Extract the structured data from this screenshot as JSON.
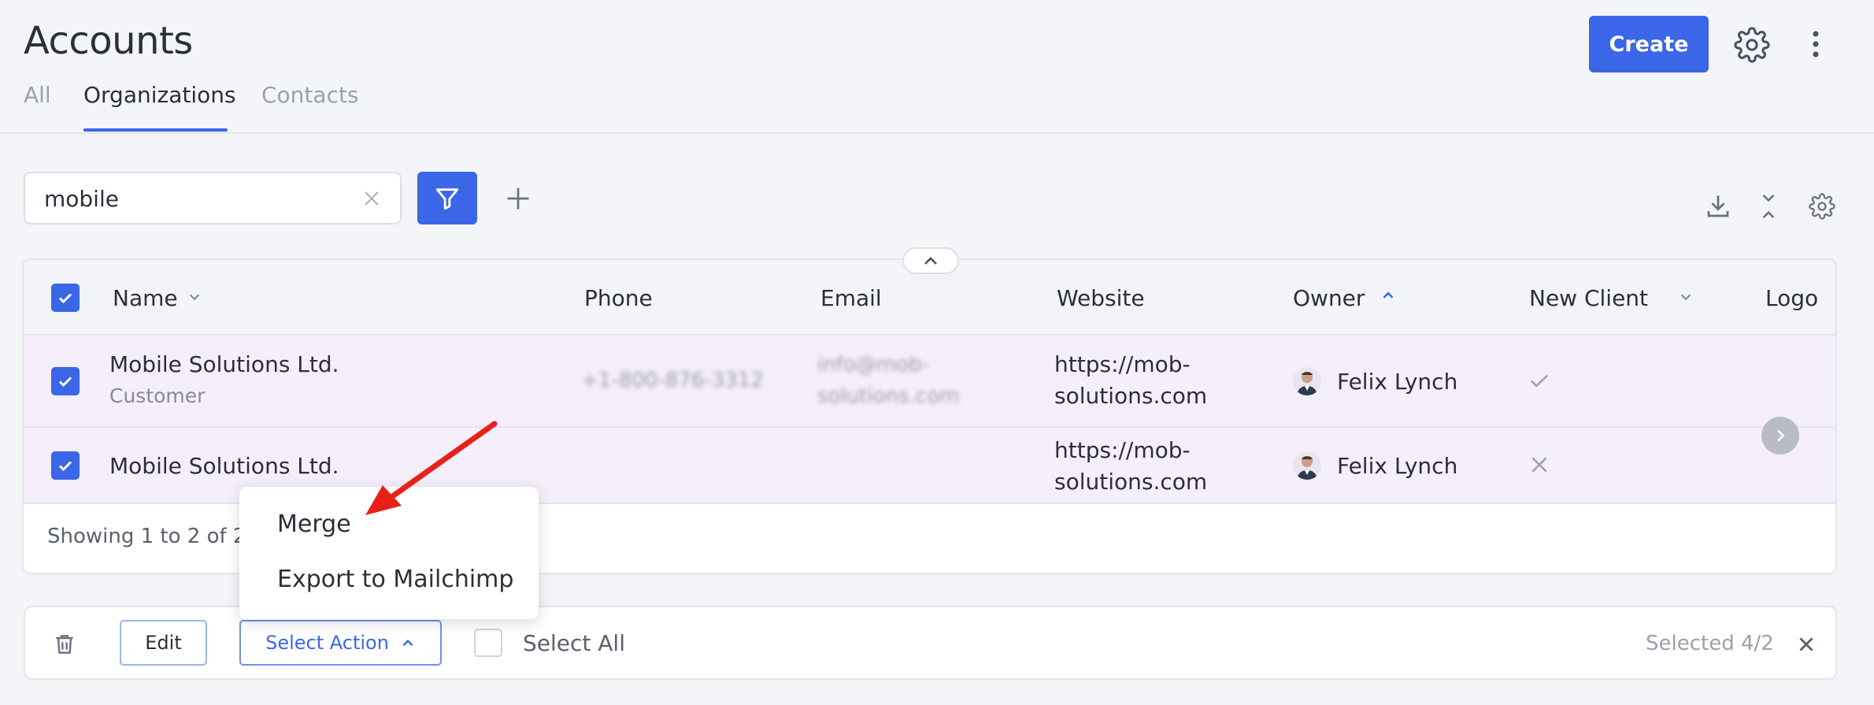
{
  "page": {
    "title": "Accounts"
  },
  "tabs": [
    {
      "label": "All"
    },
    {
      "label": "Organizations"
    },
    {
      "label": "Contacts"
    }
  ],
  "header": {
    "create_label": "Create"
  },
  "search": {
    "value": "mobile"
  },
  "table": {
    "columns": [
      "Name",
      "Phone",
      "Email",
      "Website",
      "Owner",
      "New Client",
      "Logo"
    ],
    "rows": [
      {
        "name": "Mobile Solutions Ltd.",
        "type": "Customer",
        "phone": "+1-800-876-3312",
        "email_line1": "info@mob-",
        "email_line2": "solutions.com",
        "website_line1": "https://mob-",
        "website_line2": "solutions.com",
        "owner": "Felix Lynch",
        "new_client": "check-icon"
      },
      {
        "name": "Mobile Solutions Ltd.",
        "type": "",
        "phone": "",
        "email_line1": "",
        "email_line2": "",
        "website_line1": "https://mob-",
        "website_line2": "solutions.com",
        "owner": "Felix Lynch",
        "new_client": "close-icon"
      }
    ],
    "footer_text": "Showing 1 to 2 of 2"
  },
  "menu": {
    "items": [
      {
        "label": "Merge"
      },
      {
        "label": "Export to Mailchimp"
      }
    ]
  },
  "action_bar": {
    "edit_label": "Edit",
    "select_action_label": "Select Action",
    "select_all_label": "Select All",
    "selected_text": "Selected 4/2"
  },
  "colors": {
    "accent": "#3b66e8",
    "row_selected": "#f5eefb",
    "annotation_arrow": "#e8201a"
  }
}
